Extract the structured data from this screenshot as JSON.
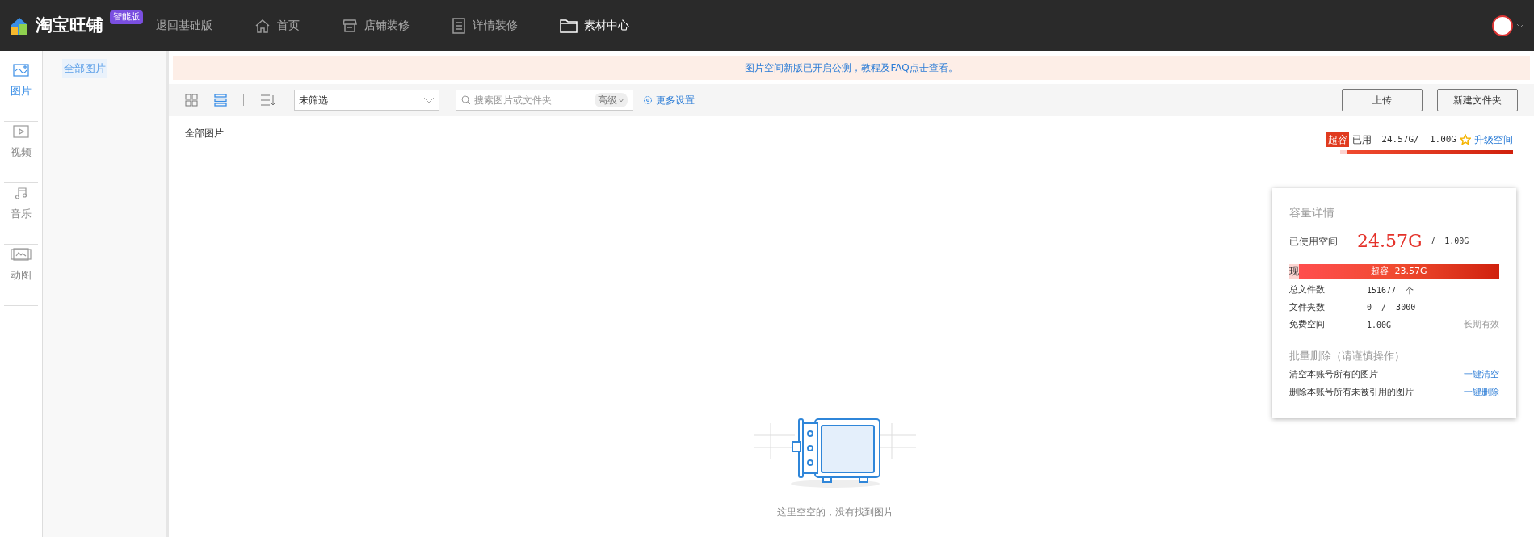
{
  "topbar": {
    "logo": "淘宝旺铺",
    "edition_badge": "智能版",
    "back_link": "退回基础版",
    "nav": [
      {
        "label": "首页",
        "kind": "home",
        "selected": false
      },
      {
        "label": "店铺装修",
        "kind": "store",
        "selected": false
      },
      {
        "label": "详情装修",
        "kind": "doc",
        "selected": false
      },
      {
        "label": "素材中心",
        "kind": "folder",
        "selected": true
      }
    ]
  },
  "rail": [
    {
      "label": "图片",
      "kind": "image",
      "selected": true
    },
    {
      "label": "视频",
      "kind": "video",
      "selected": false
    },
    {
      "label": "音乐",
      "kind": "music",
      "selected": false
    },
    {
      "label": "动图",
      "kind": "gif",
      "selected": false
    }
  ],
  "folders": [
    {
      "label": "全部图片",
      "selected": true
    }
  ],
  "notice": "图片空间新版已开启公测，教程及FAQ点击查看。",
  "toolbar": {
    "views": [
      {
        "kind": "grid",
        "selected": false
      },
      {
        "kind": "list",
        "selected": true
      }
    ],
    "filter": "未筛选",
    "search_placeholder": "搜索图片或文件夹",
    "advanced": "高级",
    "more_settings": "更多设置",
    "buttons": [
      "上传",
      "新建文件夹"
    ]
  },
  "breadcrumb": "全部图片",
  "usage": {
    "badge": "超容",
    "label": "已用",
    "amount": "24.57G/  1.00G",
    "upgrade": "升级空间",
    "level": 1
  },
  "popup": {
    "title": "容量详情",
    "used_label": "已使用空间",
    "used": "24.57G",
    "slash": "/",
    "total": "1.00G",
    "bar": {
      "left": "现",
      "text": "超容  23.57G",
      "level": 1
    },
    "rows": [
      {
        "label": "总文件数",
        "value": "151677  个",
        "note": null
      },
      {
        "label": "文件夹数",
        "value": "0  /  3000",
        "note": null
      },
      {
        "label": "免费空间",
        "value": "1.00G",
        "note": "长期有效"
      }
    ],
    "bulk_title": "批量删除（请谨慎操作）",
    "actions": [
      {
        "label": "清空本账号所有的图片",
        "link": "一键清空"
      },
      {
        "label": "删除本账号所有未被引用的图片",
        "link": "一键删除"
      }
    ]
  },
  "empty": {
    "message": "这里空空的，没有找到图片"
  }
}
